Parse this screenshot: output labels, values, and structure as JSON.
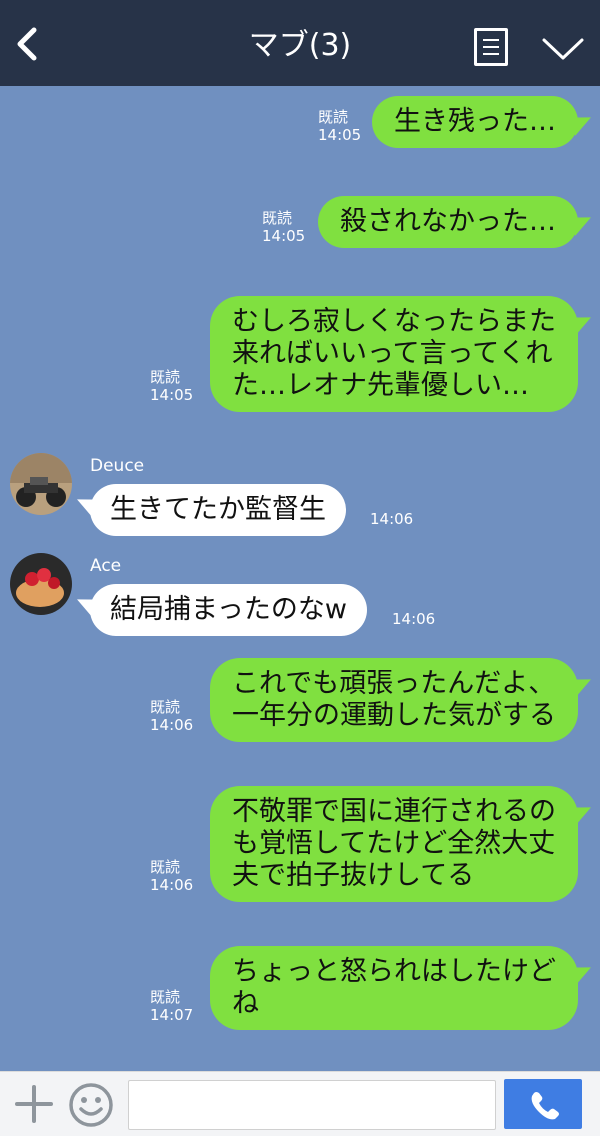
{
  "header": {
    "title": "マブ(3)",
    "back_icon": "chevron-left-icon",
    "notes_icon": "notes-icon",
    "menu_icon": "chevron-down-icon"
  },
  "messages": [
    {
      "type": "sent",
      "text": "生き残った…",
      "status": "既読",
      "time": "14:05"
    },
    {
      "type": "sent",
      "text": "殺されなかった…",
      "status": "既読",
      "time": "14:05"
    },
    {
      "type": "sent",
      "lines": [
        "むしろ寂しくなったらまた",
        "来ればいいって言ってくれ",
        "た…レオナ先輩優しい…"
      ],
      "status": "既読",
      "time": "14:05"
    },
    {
      "type": "received",
      "sender": "Deuce",
      "text": "生きてたか監督生",
      "time": "14:06"
    },
    {
      "type": "received",
      "sender": "Ace",
      "text": "結局捕まったのなw",
      "time": "14:06"
    },
    {
      "type": "sent",
      "lines": [
        "これでも頑張ったんだよ、",
        "一年分の運動した気がする"
      ],
      "status": "既読",
      "time": "14:06"
    },
    {
      "type": "sent",
      "lines": [
        "不敬罪で国に連行されるの",
        "も覚悟してたけど全然大丈",
        "夫で拍子抜けしてる"
      ],
      "status": "既読",
      "time": "14:06"
    },
    {
      "type": "sent",
      "lines": [
        "ちょっと怒られはしたけど",
        "ね"
      ],
      "status": "既読",
      "time": "14:07"
    }
  ],
  "input_bar": {
    "plus_icon": "plus-icon",
    "sticker_icon": "smiley-icon",
    "placeholder": "",
    "call_icon": "phone-icon"
  },
  "colors": {
    "header_bg": "#273348",
    "chat_bg": "#7090c0",
    "sent_bubble": "#80e040",
    "received_bubble": "#ffffff",
    "call_button": "#3f7de3"
  }
}
